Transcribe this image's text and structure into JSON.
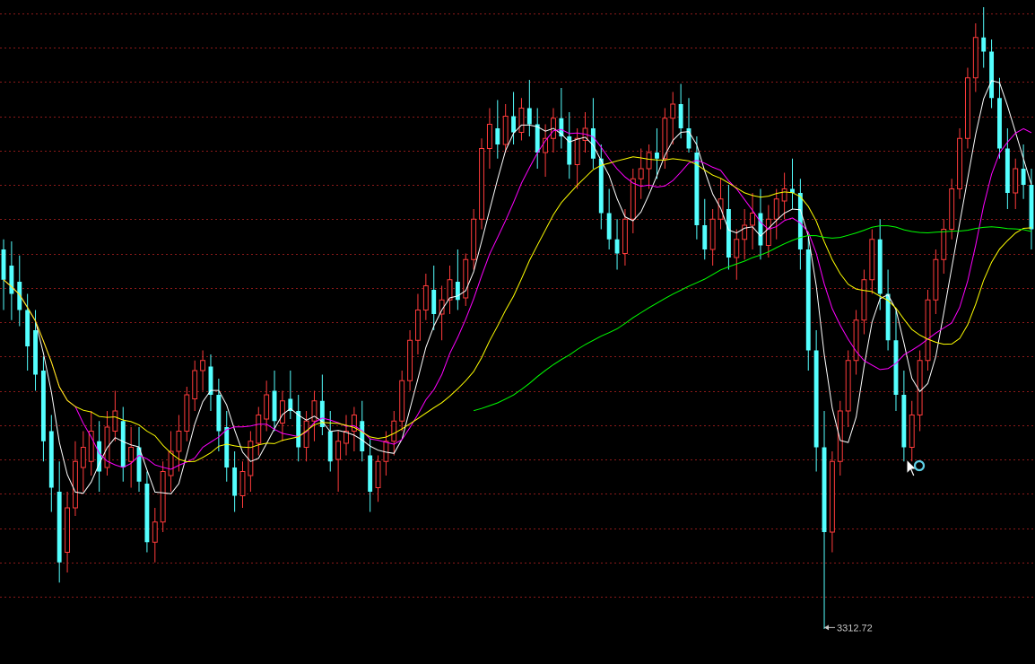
{
  "chart_data": {
    "type": "candlestick",
    "title": "",
    "xlabel": "",
    "ylabel": "",
    "grid": true,
    "ylim": [
      3300,
      3620
    ],
    "gridlines": [
      3328,
      3345,
      3362,
      3379,
      3396,
      3413,
      3430,
      3447,
      3464,
      3481,
      3498,
      3515,
      3532,
      3549,
      3566,
      3583,
      3600,
      3617
    ],
    "colors": {
      "background": "#000000",
      "grid": "#8b1a1a",
      "up": "#ff3b3b",
      "down": "#54ffff",
      "ma5": "#ffffff",
      "ma10": "#ff00ff",
      "ma20": "#ffff00",
      "ma60": "#00ff00"
    },
    "candles": [
      [
        3500,
        3505,
        3470,
        3485
      ],
      [
        3492,
        3504,
        3465,
        3478
      ],
      [
        3484,
        3497,
        3462,
        3470
      ],
      [
        3470,
        3478,
        3440,
        3452
      ],
      [
        3460,
        3470,
        3430,
        3438
      ],
      [
        3440,
        3447,
        3395,
        3405
      ],
      [
        3410,
        3418,
        3370,
        3382
      ],
      [
        3380,
        3395,
        3335,
        3345
      ],
      [
        3350,
        3380,
        3340,
        3372
      ],
      [
        3372,
        3405,
        3368,
        3395
      ],
      [
        3392,
        3410,
        3380,
        3402
      ],
      [
        3395,
        3420,
        3388,
        3410
      ],
      [
        3405,
        3415,
        3380,
        3390
      ],
      [
        3392,
        3420,
        3388,
        3412
      ],
      [
        3410,
        3430,
        3405,
        3420
      ],
      [
        3415,
        3422,
        3385,
        3392
      ],
      [
        3395,
        3412,
        3382,
        3402
      ],
      [
        3402,
        3412,
        3380,
        3385
      ],
      [
        3384,
        3390,
        3350,
        3355
      ],
      [
        3355,
        3372,
        3345,
        3365
      ],
      [
        3365,
        3395,
        3360,
        3390
      ],
      [
        3388,
        3410,
        3380,
        3400
      ],
      [
        3400,
        3418,
        3390,
        3410
      ],
      [
        3410,
        3432,
        3405,
        3428
      ],
      [
        3426,
        3445,
        3420,
        3440
      ],
      [
        3440,
        3450,
        3430,
        3445
      ],
      [
        3442,
        3448,
        3420,
        3428
      ],
      [
        3428,
        3436,
        3400,
        3410
      ],
      [
        3412,
        3420,
        3385,
        3392
      ],
      [
        3392,
        3400,
        3370,
        3378
      ],
      [
        3378,
        3395,
        3372,
        3390
      ],
      [
        3388,
        3410,
        3380,
        3405
      ],
      [
        3404,
        3422,
        3398,
        3418
      ],
      [
        3416,
        3435,
        3410,
        3428
      ],
      [
        3430,
        3440,
        3410,
        3415
      ],
      [
        3414,
        3430,
        3405,
        3425
      ],
      [
        3426,
        3440,
        3416,
        3420
      ],
      [
        3420,
        3428,
        3395,
        3402
      ],
      [
        3402,
        3420,
        3395,
        3415
      ],
      [
        3415,
        3430,
        3405,
        3425
      ],
      [
        3425,
        3438,
        3408,
        3412
      ],
      [
        3410,
        3420,
        3390,
        3395
      ],
      [
        3396,
        3410,
        3380,
        3405
      ],
      [
        3404,
        3418,
        3398,
        3410
      ],
      [
        3410,
        3422,
        3400,
        3418
      ],
      [
        3415,
        3425,
        3395,
        3400
      ],
      [
        3398,
        3406,
        3370,
        3380
      ],
      [
        3382,
        3398,
        3375,
        3395
      ],
      [
        3395,
        3410,
        3388,
        3405
      ],
      [
        3405,
        3420,
        3398,
        3415
      ],
      [
        3415,
        3440,
        3410,
        3435
      ],
      [
        3435,
        3460,
        3430,
        3455
      ],
      [
        3455,
        3478,
        3448,
        3470
      ],
      [
        3470,
        3488,
        3465,
        3482
      ],
      [
        3480,
        3492,
        3460,
        3468
      ],
      [
        3468,
        3482,
        3455,
        3475
      ],
      [
        3475,
        3492,
        3468,
        3485
      ],
      [
        3484,
        3500,
        3470,
        3475
      ],
      [
        3476,
        3498,
        3472,
        3495
      ],
      [
        3495,
        3520,
        3490,
        3515
      ],
      [
        3515,
        3555,
        3510,
        3550
      ],
      [
        3550,
        3570,
        3540,
        3562
      ],
      [
        3560,
        3574,
        3545,
        3552
      ],
      [
        3552,
        3572,
        3548,
        3566
      ],
      [
        3566,
        3578,
        3552,
        3558
      ],
      [
        3558,
        3575,
        3554,
        3570
      ],
      [
        3570,
        3584,
        3556,
        3562
      ],
      [
        3562,
        3570,
        3540,
        3548
      ],
      [
        3548,
        3562,
        3536,
        3555
      ],
      [
        3555,
        3570,
        3548,
        3565
      ],
      [
        3565,
        3580,
        3550,
        3556
      ],
      [
        3556,
        3568,
        3535,
        3542
      ],
      [
        3542,
        3560,
        3530,
        3555
      ],
      [
        3554,
        3568,
        3548,
        3560
      ],
      [
        3560,
        3575,
        3540,
        3545
      ],
      [
        3545,
        3552,
        3510,
        3518
      ],
      [
        3518,
        3530,
        3500,
        3505
      ],
      [
        3505,
        3515,
        3490,
        3498
      ],
      [
        3498,
        3520,
        3492,
        3515
      ],
      [
        3515,
        3540,
        3508,
        3535
      ],
      [
        3535,
        3550,
        3525,
        3540
      ],
      [
        3540,
        3552,
        3530,
        3548
      ],
      [
        3548,
        3560,
        3535,
        3545
      ],
      [
        3545,
        3570,
        3540,
        3565
      ],
      [
        3565,
        3578,
        3552,
        3572
      ],
      [
        3572,
        3582,
        3555,
        3560
      ],
      [
        3560,
        3575,
        3548,
        3550
      ],
      [
        3548,
        3556,
        3505,
        3512
      ],
      [
        3512,
        3525,
        3495,
        3500
      ],
      [
        3500,
        3520,
        3492,
        3515
      ],
      [
        3515,
        3535,
        3510,
        3525
      ],
      [
        3520,
        3532,
        3490,
        3496
      ],
      [
        3496,
        3510,
        3485,
        3505
      ],
      [
        3505,
        3520,
        3495,
        3512
      ],
      [
        3512,
        3528,
        3500,
        3518
      ],
      [
        3518,
        3530,
        3495,
        3502
      ],
      [
        3502,
        3522,
        3496,
        3515
      ],
      [
        3515,
        3530,
        3505,
        3525
      ],
      [
        3524,
        3538,
        3515,
        3530
      ],
      [
        3530,
        3545,
        3520,
        3528
      ],
      [
        3528,
        3535,
        3490,
        3500
      ],
      [
        3500,
        3506,
        3440,
        3450
      ],
      [
        3450,
        3460,
        3390,
        3402
      ],
      [
        3402,
        3420,
        3312,
        3360
      ],
      [
        3360,
        3400,
        3350,
        3395
      ],
      [
        3395,
        3425,
        3388,
        3420
      ],
      [
        3420,
        3450,
        3412,
        3445
      ],
      [
        3445,
        3470,
        3438,
        3465
      ],
      [
        3465,
        3490,
        3458,
        3485
      ],
      [
        3485,
        3510,
        3478,
        3505
      ],
      [
        3505,
        3515,
        3470,
        3478
      ],
      [
        3478,
        3490,
        3450,
        3455
      ],
      [
        3455,
        3470,
        3420,
        3428
      ],
      [
        3428,
        3440,
        3395,
        3402
      ],
      [
        3402,
        3425,
        3395,
        3418
      ],
      [
        3418,
        3450,
        3410,
        3445
      ],
      [
        3445,
        3480,
        3440,
        3475
      ],
      [
        3475,
        3500,
        3468,
        3495
      ],
      [
        3495,
        3515,
        3488,
        3510
      ],
      [
        3510,
        3535,
        3505,
        3530
      ],
      [
        3530,
        3560,
        3525,
        3555
      ],
      [
        3555,
        3590,
        3550,
        3585
      ],
      [
        3585,
        3612,
        3578,
        3605
      ],
      [
        3605,
        3620,
        3590,
        3598
      ],
      [
        3598,
        3604,
        3570,
        3575
      ],
      [
        3575,
        3585,
        3545,
        3550
      ],
      [
        3550,
        3560,
        3520,
        3528
      ],
      [
        3528,
        3545,
        3520,
        3540
      ],
      [
        3540,
        3552,
        3525,
        3532
      ],
      [
        3532,
        3540,
        3500,
        3510
      ]
    ],
    "series": [
      {
        "key": "ma5"
      },
      {
        "key": "ma10"
      },
      {
        "key": "ma20"
      },
      {
        "key": "ma60"
      }
    ],
    "annotations": [
      {
        "label": "3312.72",
        "value": 3312.72,
        "candle_index": 103
      }
    ]
  },
  "cursor": {
    "icon": "busy-cursor-icon"
  }
}
